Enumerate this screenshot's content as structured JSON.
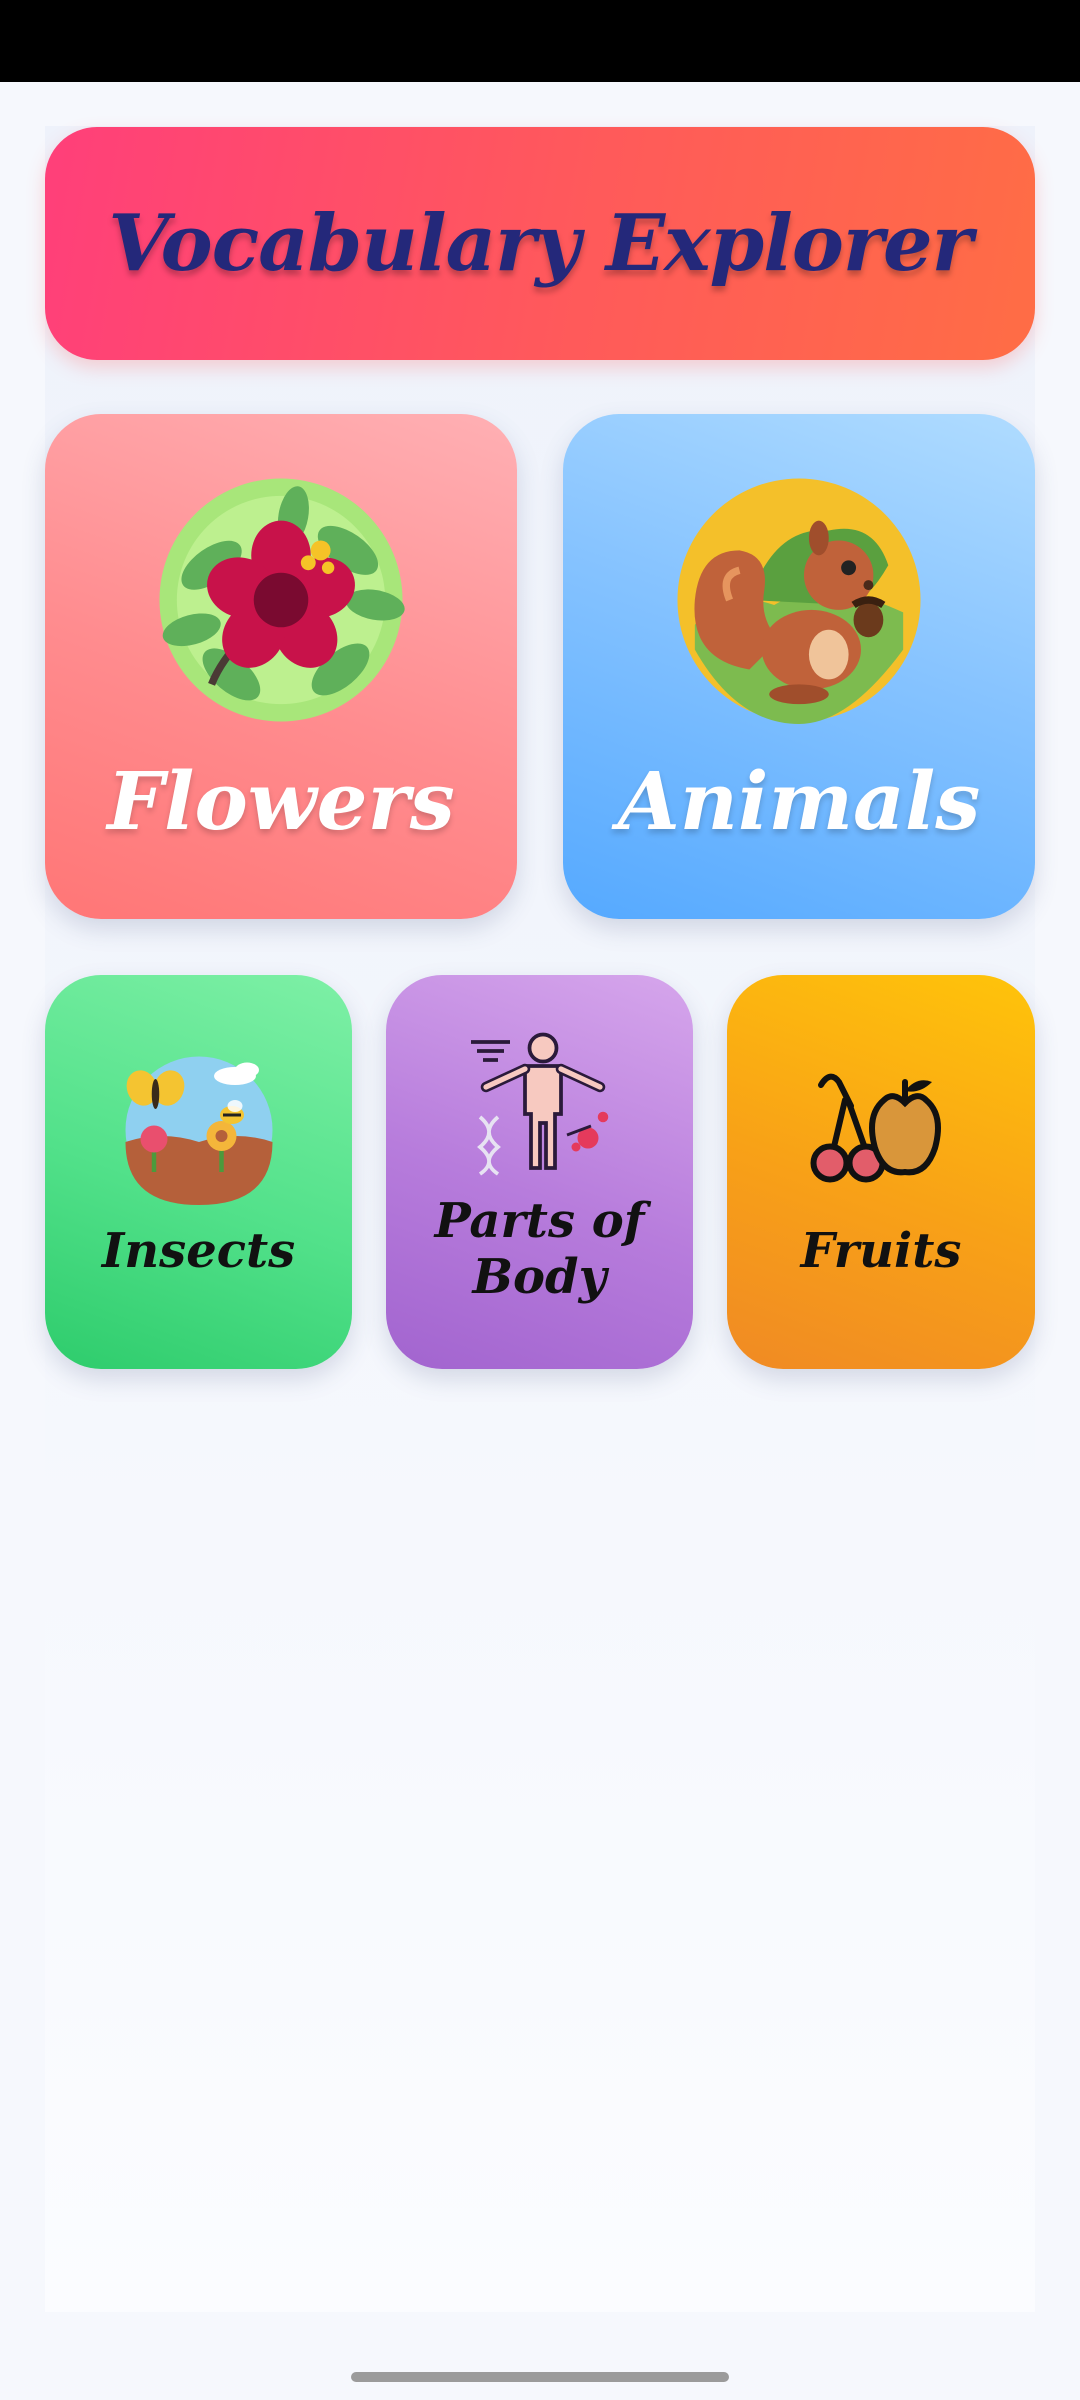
{
  "header": {
    "title": "Vocabulary Explorer"
  },
  "categories": [
    {
      "label": "Flowers",
      "icon": "flower-icon",
      "color": "#ff8c8f"
    },
    {
      "label": "Animals",
      "icon": "squirrel-icon",
      "color": "#86c3ff"
    },
    {
      "label": "Insects",
      "icon": "insects-icon",
      "color": "#52e18a"
    },
    {
      "label": "Parts of Body",
      "icon": "body-icon",
      "color": "#b77cdc"
    },
    {
      "label": "Fruits",
      "icon": "fruits-icon",
      "color": "#f8a117"
    }
  ],
  "colors": {
    "title_text": "#24287a",
    "banner_start": "#ff3f7a",
    "banner_end": "#ff6d45",
    "background": "#f6f8fd"
  }
}
